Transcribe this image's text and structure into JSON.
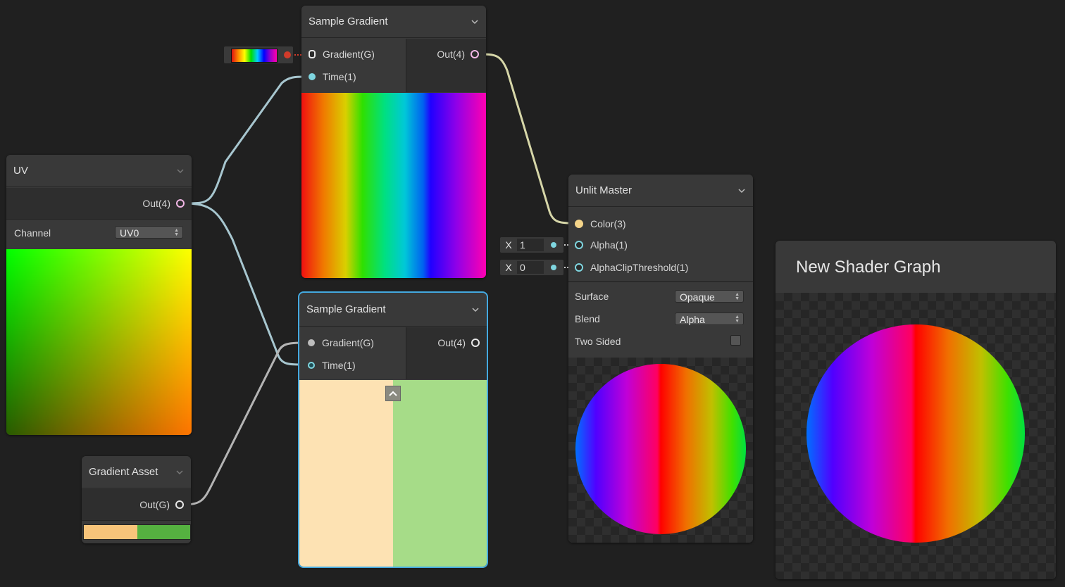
{
  "uv_node": {
    "title": "UV",
    "out_label": "Out(4)",
    "channel_label": "Channel",
    "channel_value": "UV0"
  },
  "sample_gradient_1": {
    "title": "Sample Gradient",
    "in_gradient": "Gradient(G)",
    "in_time": "Time(1)",
    "out_label": "Out(4)"
  },
  "sample_gradient_2": {
    "title": "Sample Gradient",
    "in_gradient": "Gradient(G)",
    "in_time": "Time(1)",
    "out_label": "Out(4)"
  },
  "gradient_asset": {
    "title": "Gradient Asset",
    "out_label": "Out(G)",
    "colors": [
      "#f7c47a",
      "#55b140"
    ]
  },
  "unlit_master": {
    "title": "Unlit Master",
    "in_color": "Color(3)",
    "in_alpha": "Alpha(1)",
    "in_alpha_clip": "AlphaClipThreshold(1)",
    "surface_label": "Surface",
    "surface_value": "Opaque",
    "blend_label": "Blend",
    "blend_value": "Alpha",
    "two_sided_label": "Two Sided",
    "two_sided_checked": false
  },
  "inline_inputs": {
    "alpha_axis": "X",
    "alpha_value": "1",
    "clip_axis": "X",
    "clip_value": "0"
  },
  "preview_window": {
    "title": "New Shader Graph"
  },
  "colors": {
    "background": "#202020",
    "node": "#393939",
    "selection": "#44a9e0",
    "port_cyan": "#7fd6e0",
    "port_pink": "#f2b7e6",
    "port_yellow": "#f5d58a",
    "gradient_peach": "#fde2b3",
    "gradient_green": "#a6dc88"
  }
}
